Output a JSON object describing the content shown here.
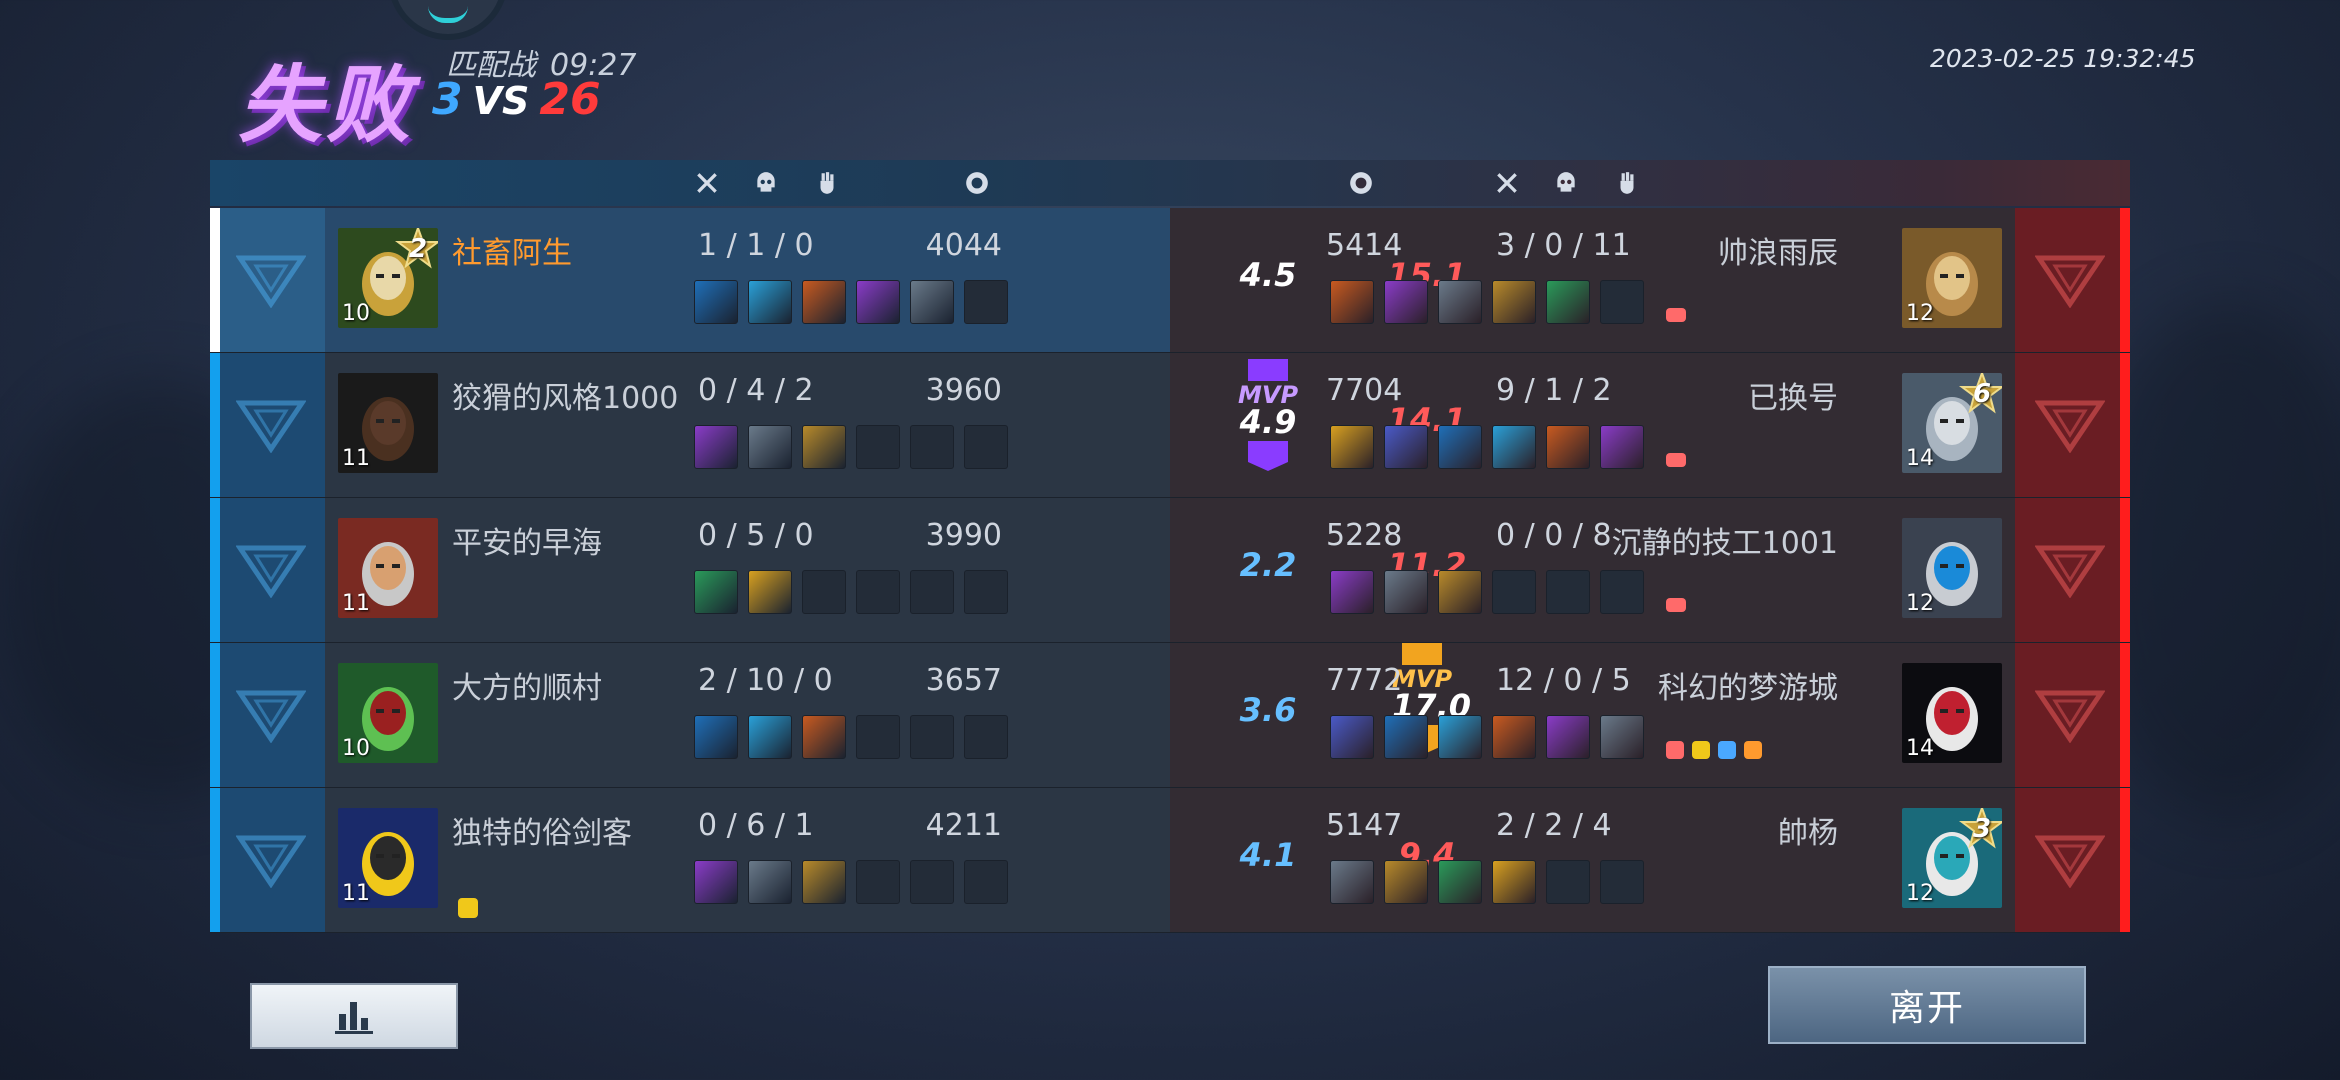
{
  "header": {
    "result": "失败",
    "mode": "匹配战",
    "duration": "09:27",
    "score_blue": "3",
    "score_vs": "VS",
    "score_red": "26",
    "datetime": "2023-02-25 19:32:45"
  },
  "columns": {
    "left": [
      "kills-icon",
      "deaths-icon",
      "assists-icon",
      "gold-icon"
    ],
    "right": [
      "gold-icon",
      "kills-icon",
      "deaths-icon",
      "assists-icon"
    ]
  },
  "left_team": [
    {
      "name": "社畜阿生",
      "level": "10",
      "star": "2",
      "kda": "1 / 1 / 0",
      "gold": "4044",
      "rating": "4.5",
      "mvp": "",
      "items": 5,
      "badges": 0,
      "me": true,
      "portrait_colors": [
        "#2d4a1e",
        "#c9a23a",
        "#e8d8a8"
      ]
    },
    {
      "name": "狡猾的风格1000",
      "level": "11",
      "star": "",
      "kda": "0 / 4 / 2",
      "gold": "3960",
      "rating": "4.9",
      "mvp": "MVP",
      "items": 3,
      "badges": 0,
      "me": false,
      "portrait_colors": [
        "#1a1a1a",
        "#4a3020",
        "#5a3a2a"
      ]
    },
    {
      "name": "平安的早海",
      "level": "11",
      "star": "",
      "kda": "0 / 5 / 0",
      "gold": "3990",
      "rating": "2.2",
      "mvp": "",
      "items": 2,
      "badges": 0,
      "me": false,
      "portrait_colors": [
        "#7a2a22",
        "#c8c8c8",
        "#d8a070"
      ]
    },
    {
      "name": "大方的顺村",
      "level": "10",
      "star": "",
      "kda": "2 / 10 / 0",
      "gold": "3657",
      "rating": "3.6",
      "mvp": "",
      "items": 3,
      "badges": 0,
      "me": false,
      "portrait_colors": [
        "#1f5a2a",
        "#5ec052",
        "#9a2020"
      ]
    },
    {
      "name": "独特的俗剑客",
      "level": "11",
      "star": "",
      "kda": "0 / 6 / 1",
      "gold": "4211",
      "rating": "4.1",
      "mvp": "",
      "items": 3,
      "badges": 1,
      "me": false,
      "portrait_colors": [
        "#1a2a6a",
        "#f0c81a",
        "#2a2a2a"
      ]
    }
  ],
  "right_team": [
    {
      "name": "帅浪雨辰",
      "level": "12",
      "star": "",
      "kda": "3 / 0 / 11",
      "gold": "5414",
      "rating": "15.1",
      "mvp": "",
      "items": 5,
      "badges": 1,
      "portrait_colors": [
        "#7a5a2a",
        "#b88a4a",
        "#e2c488"
      ]
    },
    {
      "name": "已换号",
      "level": "14",
      "star": "6",
      "kda": "9 / 1 / 2",
      "gold": "7704",
      "rating": "14.1",
      "mvp": "",
      "items": 6,
      "badges": 1,
      "portrait_colors": [
        "#4a5a6a",
        "#a8b4c0",
        "#d8dde2"
      ]
    },
    {
      "name": "沉静的技工1001",
      "level": "12",
      "star": "",
      "kda": "0 / 0 / 8",
      "gold": "5228",
      "rating": "11.2",
      "mvp": "",
      "items": 3,
      "badges": 1,
      "portrait_colors": [
        "#3a4250",
        "#c8ccd2",
        "#1a8ad8"
      ]
    },
    {
      "name": "科幻的梦游城",
      "level": "14",
      "star": "",
      "kda": "12 / 0 / 5",
      "gold": "7772",
      "rating": "17.0",
      "mvp": "MVP",
      "items": 6,
      "badges": 4,
      "portrait_colors": [
        "#0c0c10",
        "#e8e8e8",
        "#c02030"
      ]
    },
    {
      "name": "帥杨",
      "level": "12",
      "star": "3",
      "kda": "2 / 2 / 4",
      "gold": "5147",
      "rating": "9.4",
      "mvp": "",
      "items": 4,
      "badges": 0,
      "portrait_colors": [
        "#1a6a7a",
        "#e8e8e8",
        "#2aa8b8"
      ]
    }
  ],
  "footer": {
    "chart_button": "bar-chart-icon",
    "leave_label": "离开"
  },
  "colors": {
    "blue_team": "#13a0ee",
    "red_team": "#ff1d1d",
    "mvp_left": "#8a3cff",
    "mvp_right": "#f2a41f",
    "me_name": "#ff9a2e"
  }
}
